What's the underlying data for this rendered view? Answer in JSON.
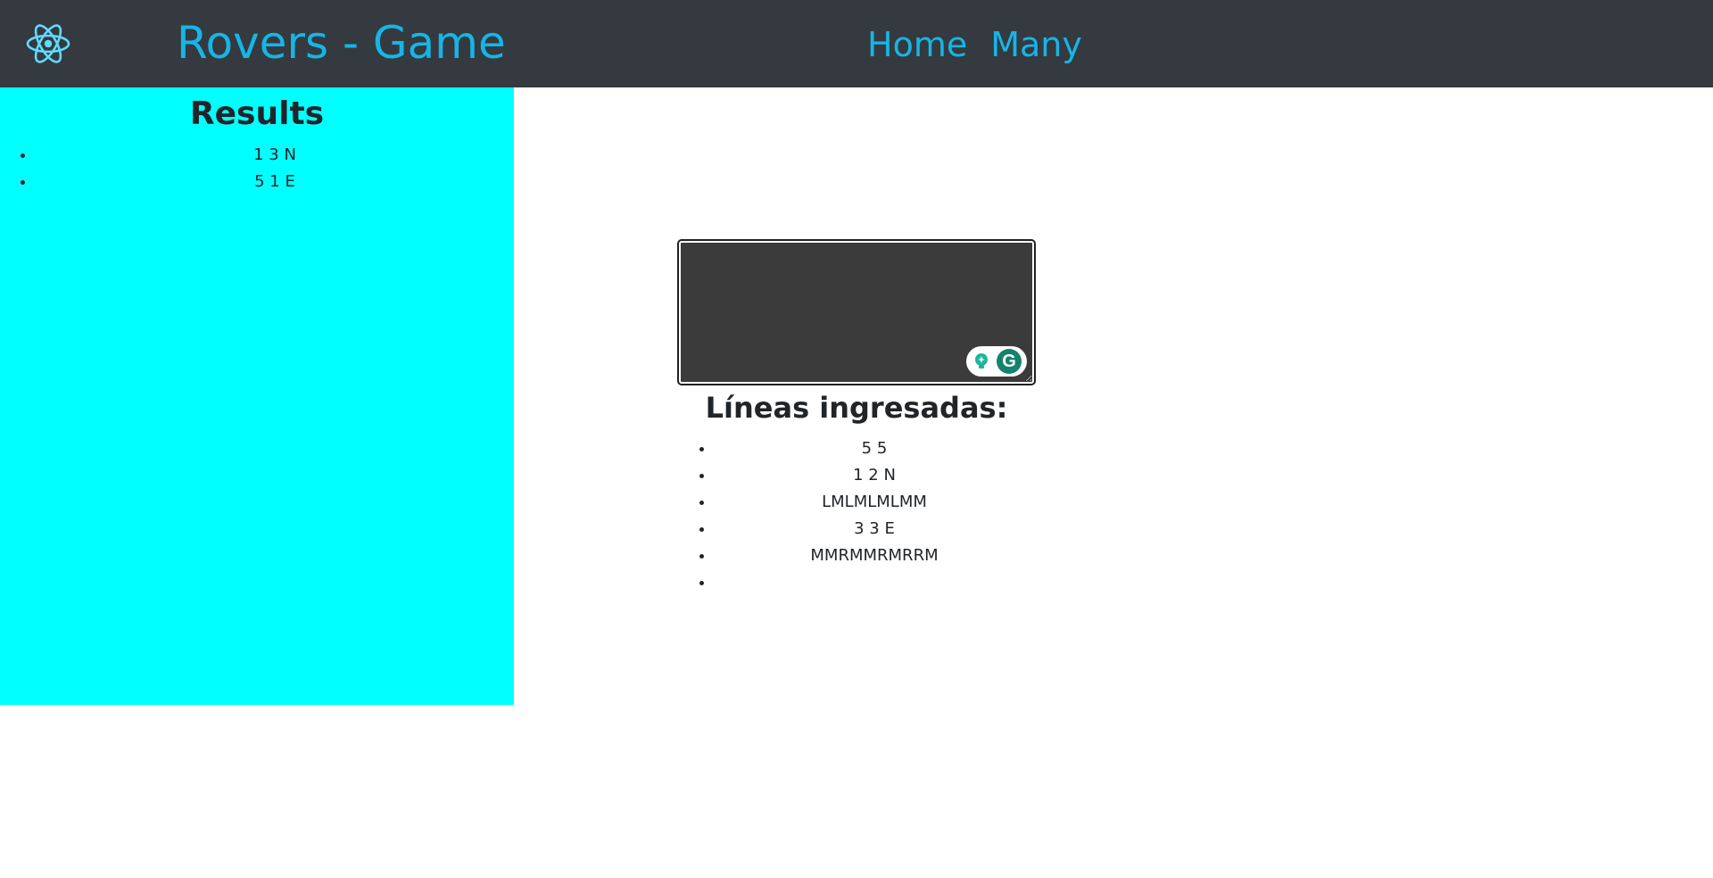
{
  "header": {
    "logo_icon": "react-atom-icon",
    "brand": "Rovers - Game",
    "nav": [
      {
        "label": "Home"
      },
      {
        "label": "Many"
      }
    ],
    "colors": {
      "background": "#343a40",
      "link": "#17b5e6"
    }
  },
  "sidebar": {
    "title": "Results",
    "background": "#00ffff",
    "results": [
      "1 3 N",
      "5 1 E"
    ]
  },
  "main": {
    "textarea": {
      "value": "",
      "grammarly_icons": [
        "grammarly-suggestion-icon",
        "grammarly-g-icon"
      ]
    },
    "lines_title": "Líneas ingresadas:",
    "lines": [
      "5 5",
      "1 2 N",
      "LMLMLMLMM",
      "3 3 E",
      "MMRMMRMRRM",
      ""
    ]
  }
}
